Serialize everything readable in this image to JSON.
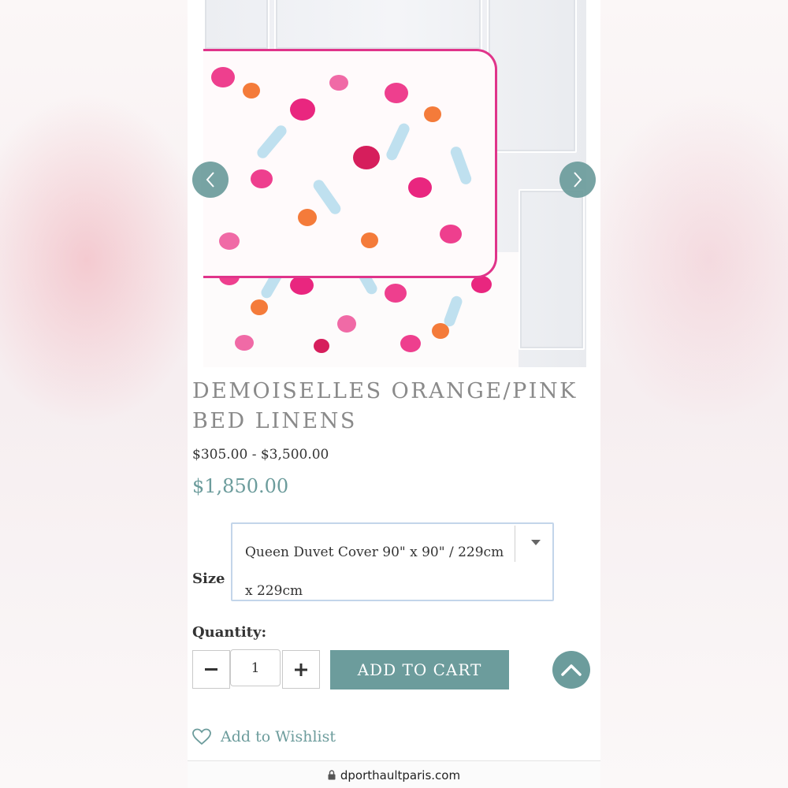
{
  "product": {
    "title": "DEMOISELLES ORANGE/PINK BED LINENS",
    "price_range": "$305.00 - $3,500.00",
    "price_current": "$1,850.00"
  },
  "size": {
    "label": "Size",
    "selected": "Queen Duvet Cover 90\" x 90\" / 229cm x 229cm"
  },
  "quantity": {
    "label": "Quantity:",
    "value": "1"
  },
  "actions": {
    "add_to_cart": "ADD TO CART",
    "wishlist": "Add to Wishlist"
  },
  "browser": {
    "url": "dporthaultparis.com"
  },
  "icons": {
    "prev": "chevron-left-icon",
    "next": "chevron-right-icon",
    "caret": "caret-down-icon",
    "minus": "minus-icon",
    "plus": "plus-icon",
    "scroll_top": "chevron-up-icon",
    "wishlist": "heart-outline-icon",
    "lock": "lock-icon"
  },
  "colors": {
    "accent": "#6c9c9c",
    "select_border": "#c3d5ea",
    "scallop_pink": "#e0348a"
  }
}
